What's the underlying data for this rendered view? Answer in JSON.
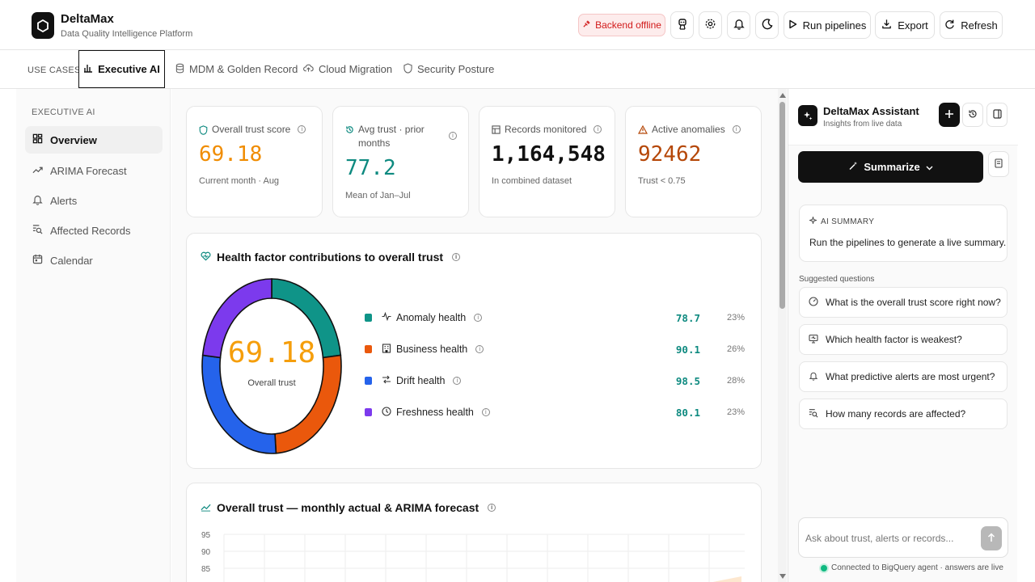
{
  "app": {
    "name": "DeltaMax",
    "subtitle": "Data Quality Intelligence Platform"
  },
  "header": {
    "status_badge": "Backend offline",
    "run_label": "Run pipelines",
    "export_label": "Export",
    "refresh_label": "Refresh"
  },
  "use_cases": {
    "label": "USE CASES",
    "tabs": [
      {
        "label": "Executive AI",
        "icon": "bar-chart-icon",
        "active": true
      },
      {
        "label": "MDM & Golden Record",
        "icon": "database-icon"
      },
      {
        "label": "Cloud Migration",
        "icon": "cloud-upload-icon"
      },
      {
        "label": "Security Posture",
        "icon": "shield-icon"
      }
    ]
  },
  "sidebar": {
    "title": "EXECUTIVE AI",
    "items": [
      {
        "label": "Overview",
        "icon": "grid-icon",
        "active": true
      },
      {
        "label": "ARIMA Forecast",
        "icon": "trending-up-icon"
      },
      {
        "label": "Alerts",
        "icon": "bell-icon"
      },
      {
        "label": "Affected Records",
        "icon": "search-list-icon"
      },
      {
        "label": "Calendar",
        "icon": "calendar-icon"
      }
    ]
  },
  "kpis": [
    {
      "label": "Overall trust score",
      "value": "69.18",
      "sub": "Current month · Aug",
      "color": "#f08c00"
    },
    {
      "label": "Avg trust · prior months",
      "value": "77.2",
      "sub": "Mean of Jan–Jul",
      "color": "#0e8a80"
    },
    {
      "label": "Records monitored",
      "value": "1,164,548",
      "sub": "In combined dataset",
      "color": "#111111"
    },
    {
      "label": "Active anomalies",
      "value": "92462",
      "sub": "Trust < 0.75",
      "color": "#b54708"
    }
  ],
  "health": {
    "title": "Health factor contributions to overall trust",
    "center_value": "69.18",
    "center_label": "Overall trust",
    "factors": [
      {
        "name": "Anomaly health",
        "value": "78.7",
        "pct": "23%",
        "share": 23,
        "color": "#0f9488",
        "icon": "activity-icon"
      },
      {
        "name": "Business health",
        "value": "90.1",
        "pct": "26%",
        "share": 26,
        "color": "#ea580c",
        "icon": "building-icon"
      },
      {
        "name": "Drift health",
        "value": "98.5",
        "pct": "28%",
        "share": 28,
        "color": "#2563eb",
        "icon": "drift-icon"
      },
      {
        "name": "Freshness health",
        "value": "80.1",
        "pct": "23%",
        "share": 23,
        "color": "#7c3aed",
        "icon": "clock-icon"
      }
    ]
  },
  "forecast": {
    "title": "Overall trust — monthly actual & ARIMA forecast",
    "y_ticks": [
      "95",
      "90",
      "85"
    ]
  },
  "assistant": {
    "title": "DeltaMax Assistant",
    "subtitle": "Insights from live data",
    "summarize_label": "Summarize",
    "ai_summary_label": "AI SUMMARY",
    "ai_summary_text": "Run the pipelines to generate a live summary.",
    "suggested_label": "Suggested questions",
    "suggestions": [
      {
        "text": "What is the overall trust score right now?",
        "icon": "gauge-icon"
      },
      {
        "text": "Which health factor is weakest?",
        "icon": "monitor-icon"
      },
      {
        "text": "What predictive alerts are most urgent?",
        "icon": "bell-icon"
      },
      {
        "text": "How many records are affected?",
        "icon": "search-list-icon"
      }
    ],
    "input_placeholder": "Ask about trust, alerts or records...",
    "connected_text": "Connected to BigQuery agent · answers are live"
  }
}
